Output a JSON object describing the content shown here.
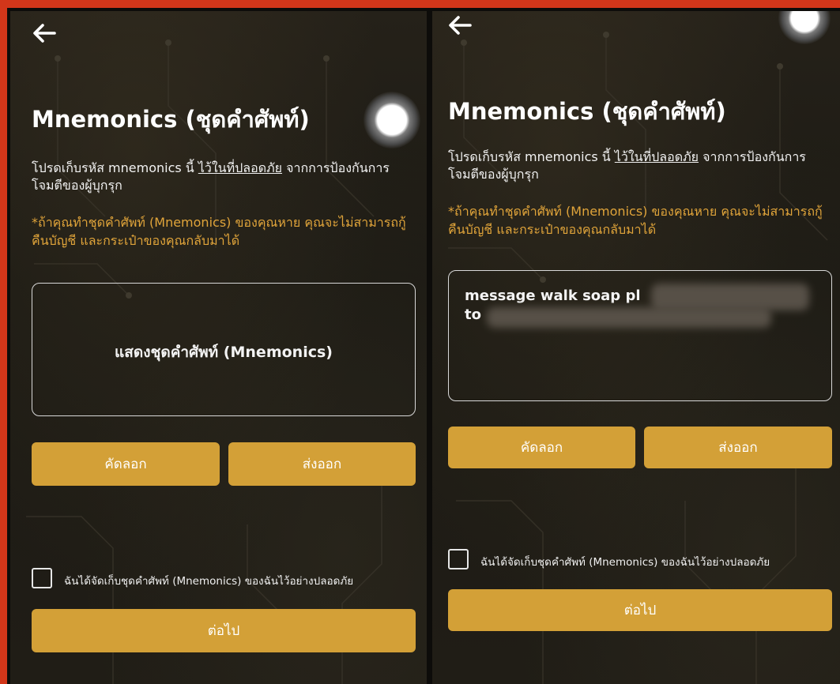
{
  "screens": [
    {
      "title": "Mnemonics (ชุดคำศัพท์)",
      "desc_before": "โปรดเก็บรหัส mnemonics นี้ ",
      "desc_link": "ไว้ในที่ปลอดภัย",
      "desc_after": " จากการป้องกันการโจมตีของผู้บุกรุก",
      "warning": "*ถ้าคุณทำชุดคำศัพท์ (Mnemonics) ของคุณหาย คุณจะไม่สามารถกู้คืนบัญชี และกระเป๋าของคุณกลับมาได้",
      "reveal_label": "แสดงชุดคำศัพท์ (Mnemonics)",
      "copy_label": "คัดลอก",
      "export_label": "ส่งออก",
      "confirm_label": "ฉันได้จัดเก็บชุดคำศัพท์ (Mnemonics) ของฉันไว้อย่างปลอดภัย",
      "next_label": "ต่อไป"
    },
    {
      "title": "Mnemonics (ชุดคำศัพท์)",
      "desc_before": "โปรดเก็บรหัส mnemonics นี้ ",
      "desc_link": "ไว้ในที่ปลอดภัย",
      "desc_after": " จากการป้องกันการโจมตีของผู้บุกรุก",
      "warning": "*ถ้าคุณทำชุดคำศัพท์ (Mnemonics) ของคุณหาย คุณจะไม่สามารถกู้คืนบัญชี และกระเป๋าของคุณกลับมาได้",
      "words_line1": "message walk soap pl",
      "words_line2": "to",
      "copy_label": "คัดลอก",
      "export_label": "ส่งออก",
      "confirm_label": "ฉันได้จัดเก็บชุดคำศัพท์ (Mnemonics) ของฉันไว้อย่างปลอดภัย",
      "next_label": "ต่อไป"
    }
  ],
  "colors": {
    "accent": "#d3a037",
    "warning": "#e0a43a",
    "border": "#d32f1a"
  }
}
